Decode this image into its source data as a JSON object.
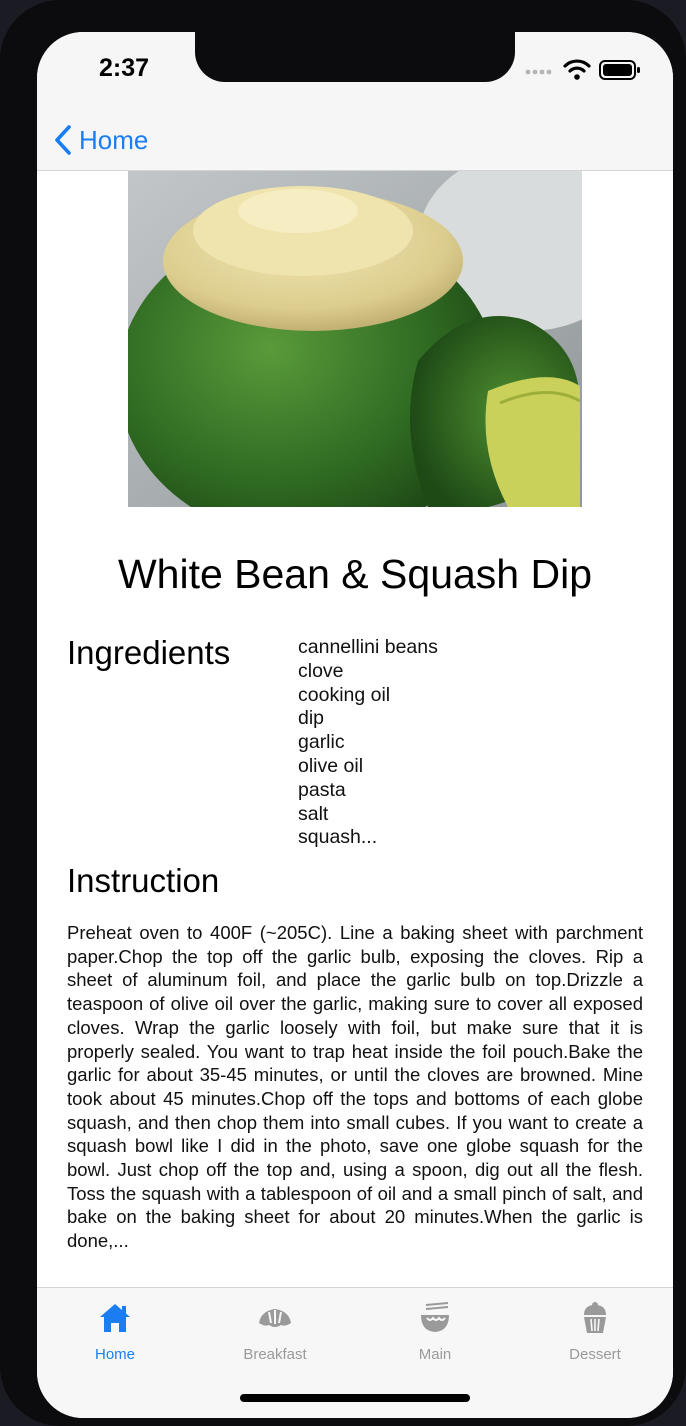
{
  "status_bar": {
    "time": "2:37"
  },
  "nav": {
    "back_label": "Home"
  },
  "recipe": {
    "title": "White Bean & Squash Dip",
    "ingredients_heading": "Ingredients",
    "ingredients": [
      "cannellini beans",
      "clove",
      "cooking oil",
      "dip",
      "garlic",
      "olive oil",
      "pasta",
      "salt",
      "squash..."
    ],
    "instruction_heading": "Instruction",
    "instruction_text": "Preheat oven to 400F (~205C). Line a baking sheet with parchment paper.Chop the top off the garlic bulb, exposing the cloves. Rip a sheet of aluminum foil, and place the garlic bulb on top.Drizzle a teaspoon of olive oil over the garlic, making sure to cover all exposed cloves. Wrap the garlic loosely with foil, but make sure that it is properly sealed. You want to trap heat inside the foil pouch.Bake the garlic for about 35-45 minutes, or until the cloves are browned. Mine took about 45 minutes.Chop off the tops and bottoms of each globe squash, and then chop them into small cubes. If you want to create a squash bowl like I did in the photo, save one globe squash for the bowl. Just chop off the top and, using a spoon, dig out all the flesh. Toss the squash with a tablespoon of oil and a small pinch of salt, and bake on the baking sheet for about 20 minutes.When the garlic is done,..."
  },
  "tabs": [
    {
      "label": "Home",
      "icon": "house-icon",
      "active": true
    },
    {
      "label": "Breakfast",
      "icon": "croissant-icon",
      "active": false
    },
    {
      "label": "Main",
      "icon": "noodle-bowl-icon",
      "active": false
    },
    {
      "label": "Dessert",
      "icon": "cupcake-icon",
      "active": false
    }
  ],
  "colors": {
    "accent": "#1a7ef2",
    "inactive": "#9a9a9a",
    "bar_bg": "#f6f6f6"
  }
}
